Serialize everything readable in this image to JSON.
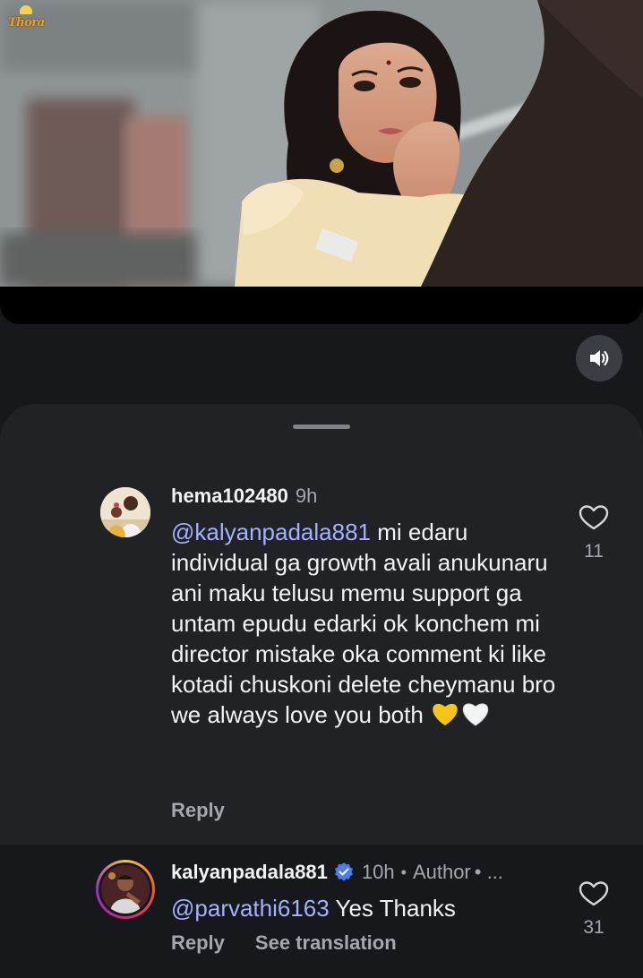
{
  "video": {
    "logo_text": "Thora"
  },
  "controls": {
    "sound_icon": "speaker-icon"
  },
  "comments": [
    {
      "username": "hema102480",
      "time": "9h",
      "mention": "@kalyanpadala881",
      "text": " mi edaru individual ga growth avali anukunaru ani maku telusu memu support ga untam epudu edarki ok konchem mi director mistake oka comment ki like kotadi chuskoni delete cheymanu bro we always love you both ",
      "emojis": [
        "yellow-heart",
        "white-heart"
      ],
      "reply_label": "Reply",
      "like_count": "11"
    },
    {
      "username": "kalyanpadala881",
      "verified": true,
      "time": "10h",
      "separator": "•",
      "author_label": "Author",
      "more": "• ...",
      "mention": "@parvathi6163",
      "text": " Yes Thanks",
      "reply_label": "Reply",
      "translate_label": "See translation",
      "like_count": "31"
    }
  ],
  "colors": {
    "background": "#16181c",
    "sheet": "#202226",
    "mention": "#a3b1ff",
    "verified": "#4a7cf6",
    "muted": "#a4a7ad"
  }
}
